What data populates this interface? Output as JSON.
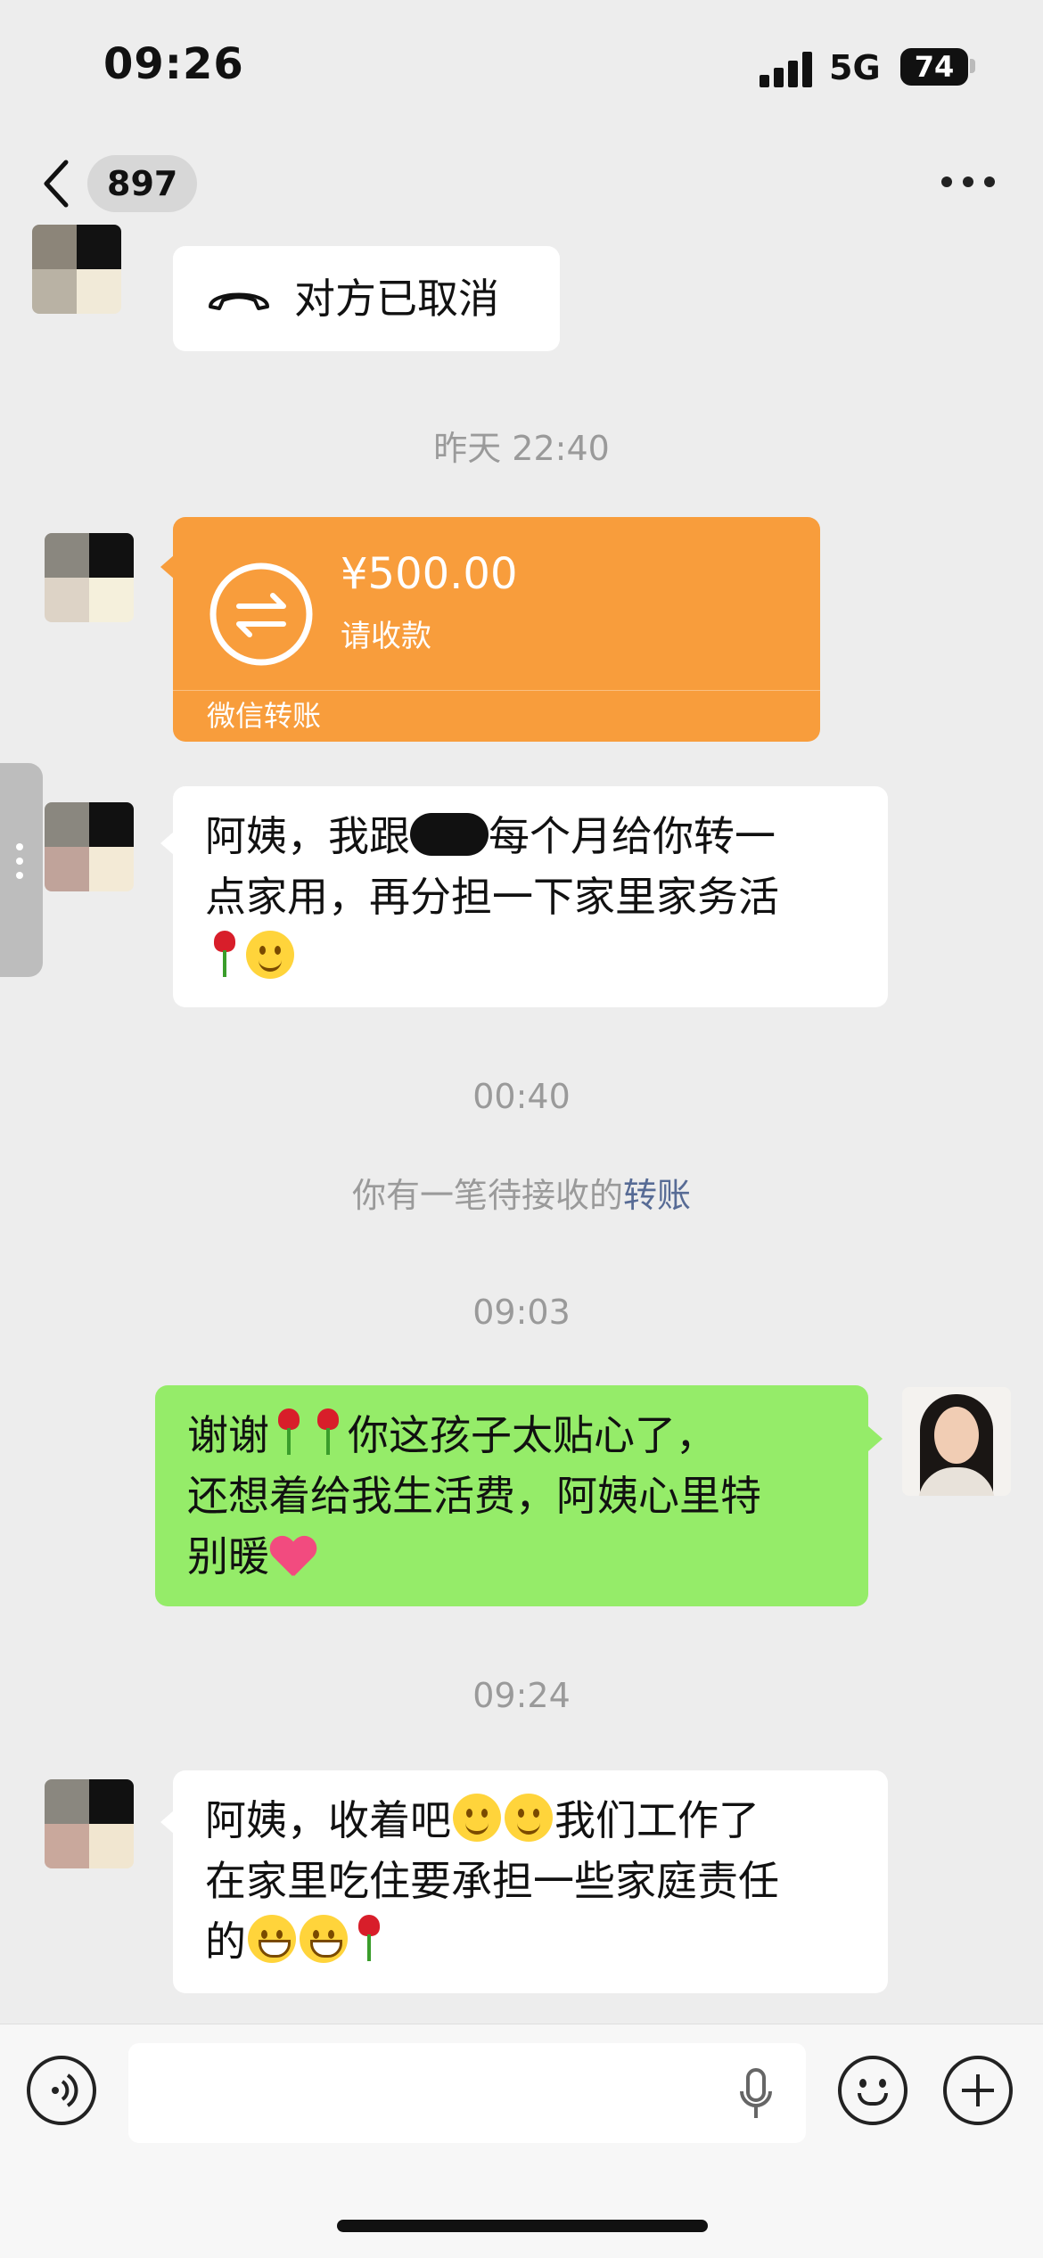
{
  "status_bar": {
    "time": "09:26",
    "network": "5G",
    "battery": "74"
  },
  "nav": {
    "count": "897"
  },
  "messages": {
    "call_status": "对方已取消",
    "ts1": "昨天 22:40",
    "transfer": {
      "amount": "¥500.00",
      "subtitle": "请收款",
      "footer": "微信转账"
    },
    "msg1": {
      "p1": "阿姨，我跟",
      "p2": "每个月给你转一",
      "line2": "点家用，再分担一下家里家务活"
    },
    "ts2": "00:40",
    "system_note": {
      "text": "你有一笔待接收的",
      "link": "转账"
    },
    "ts3": "09:03",
    "msg2": {
      "p1": "谢谢",
      "p2": "你这孩子太贴心了，",
      "line2": "还想着给我生活费，阿姨心里特",
      "line3": "别暖"
    },
    "ts4": "09:24",
    "msg3": {
      "p1": "阿姨，收着吧",
      "p2": "我们工作了",
      "line2": "在家里吃住要承担一些家庭责任",
      "line3": "的"
    }
  },
  "icons": [
    "back-chevron-icon",
    "more-icon",
    "phone-hangup-icon",
    "transfer-arrows-icon",
    "voice-input-icon",
    "microphone-icon",
    "emoji-icon",
    "plus-icon"
  ],
  "colors": {
    "background": "#ededed",
    "self_bubble": "#95ec69",
    "transfer_card": "#f89d3c",
    "link": "#576b95"
  }
}
